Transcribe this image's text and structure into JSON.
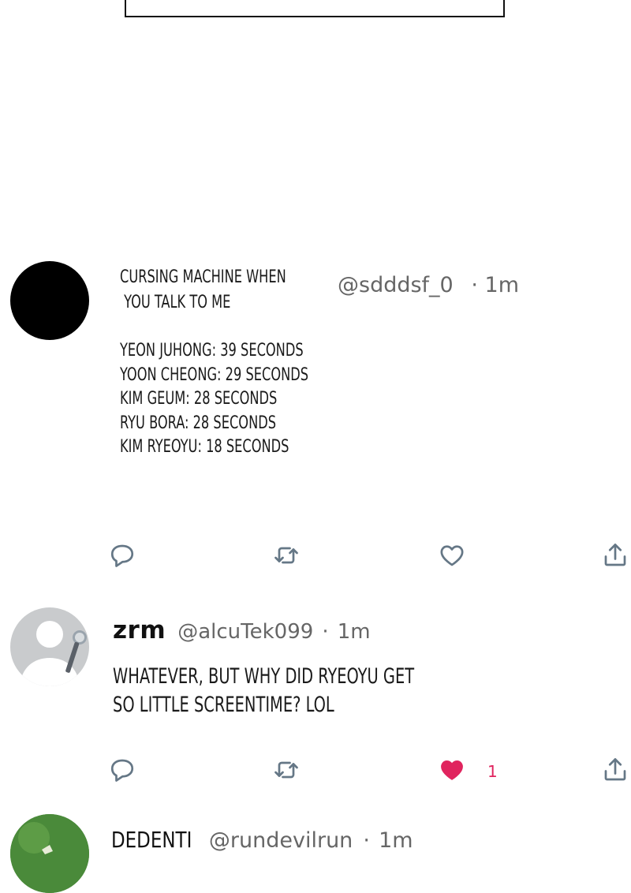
{
  "tweet1": {
    "title_line1": "CURSING MACHINE WHEN",
    "title_line2": " YOU TALK TO ME",
    "handle": "@sdddsf_0",
    "dot": "·",
    "time": "1m",
    "list": [
      "YEON JUHONG: 39 SECONDS",
      "YOON CHEONG: 29 SECONDS",
      "KIM GEUM: 28 SECONDS",
      "RYU BORA: 28 SECONDS",
      "KIM RYEOYU: 18 SECONDS"
    ]
  },
  "tweet2": {
    "name": "zrm",
    "handle": "@alcuTek099",
    "dot": "·",
    "time": "1m",
    "body_line1": "WHATEVER, BUT WHY DID RYEOYU GET",
    "body_line2": "SO LITTLE SCREENTIME? LOL",
    "like_count": "1"
  },
  "tweet3": {
    "name": "DEDENTI",
    "handle": "@rundevilrun",
    "dot": "·",
    "time": "1m"
  },
  "colors": {
    "like_active": "#e0245e",
    "icon_gray": "#657786",
    "meta_gray": "#666666"
  },
  "icons": {
    "reply": "reply-icon",
    "retweet": "retweet-icon",
    "like": "heart-icon",
    "share": "share-icon"
  }
}
